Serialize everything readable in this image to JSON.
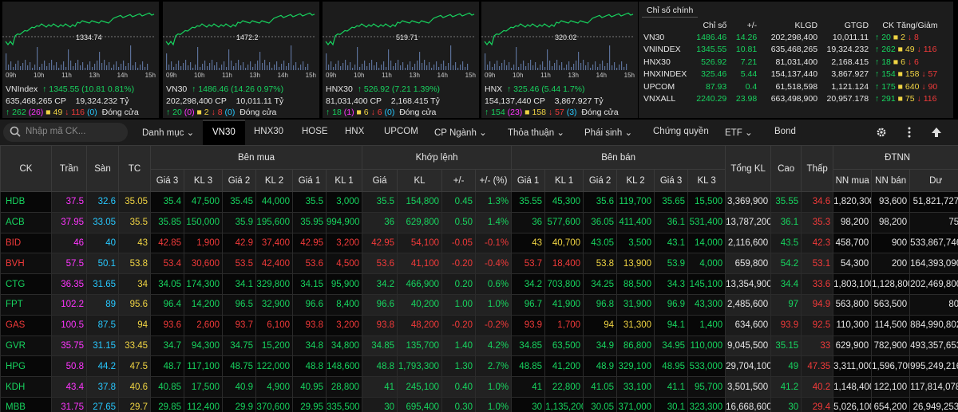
{
  "mini_charts": [
    {
      "name": "VNIndex",
      "ref_label": "1334.74",
      "price": "1345.55",
      "change": "(10.81 0.81%)",
      "vol": "635,468,265 CP",
      "value": "19,324.232 Tỷ",
      "up": "262",
      "ceil_up": "(26)",
      "same": "49",
      "down": "116",
      "floor_down": "(0)",
      "status": "Đóng cửa"
    },
    {
      "name": "VN30",
      "ref_label": "1472.2",
      "price": "1486.46",
      "change": "(14.26 0.97%)",
      "vol": "202,298,400 CP",
      "value": "10,011.11 Tỷ",
      "up": "20",
      "ceil_up": "(0)",
      "same": "2",
      "down": "8",
      "floor_down": "(0)",
      "status": "Đóng cửa"
    },
    {
      "name": "HNX30",
      "ref_label": "519.71",
      "price": "526.92",
      "change": "(7.21 1.39%)",
      "vol": "81,031,400 CP",
      "value": "2,168.415 Tỷ",
      "up": "18",
      "ceil_up": "(1)",
      "same": "6",
      "down": "6",
      "floor_down": "(0)",
      "status": "Đóng cửa"
    },
    {
      "name": "HNX",
      "ref_label": "320.02",
      "price": "325.46",
      "change": "(5.44 1.7%)",
      "vol": "154,137,440 CP",
      "value": "3,867.927 Tỷ",
      "up": "154",
      "ceil_up": "(23)",
      "same": "158",
      "down": "57",
      "floor_down": "(3)",
      "status": "Đóng cửa"
    }
  ],
  "time_ticks": [
    "09h",
    "10h",
    "11h",
    "13h",
    "14h",
    "15h"
  ],
  "summary": {
    "tab": "Chỉ số chính",
    "headers": [
      "Chỉ số",
      "+/-",
      "KLGD",
      "GTGD",
      "CK Tăng/Giảm"
    ],
    "rows": [
      {
        "name": "VN30",
        "index": "1486.46",
        "chg": "14.26",
        "klgd": "202,298,400",
        "gtgd": "10,011.11",
        "up": "20",
        "same": "2",
        "down": "8"
      },
      {
        "name": "VNINDEX",
        "index": "1345.55",
        "chg": "10.81",
        "klgd": "635,468,265",
        "gtgd": "19,324.232",
        "up": "262",
        "same": "49",
        "down": "116"
      },
      {
        "name": "HNX30",
        "index": "526.92",
        "chg": "7.21",
        "klgd": "81,031,400",
        "gtgd": "2,168.415",
        "up": "18",
        "same": "6",
        "down": "6"
      },
      {
        "name": "HNXINDEX",
        "index": "325.46",
        "chg": "5.44",
        "klgd": "154,137,440",
        "gtgd": "3,867.927",
        "up": "154",
        "same": "158",
        "down": "57"
      },
      {
        "name": "UPCOM",
        "index": "87.93",
        "chg": "0.4",
        "klgd": "61,518,598",
        "gtgd": "1,121.124",
        "up": "175",
        "same": "640",
        "down": "90"
      },
      {
        "name": "VNXALL",
        "index": "2240.29",
        "chg": "23.98",
        "klgd": "663,498,900",
        "gtgd": "20,957.178",
        "up": "291",
        "same": "75",
        "down": "116"
      }
    ]
  },
  "nav": {
    "search_placeholder": "Nhập mã CK...",
    "items": [
      "Danh mục",
      "VN30",
      "HNX30",
      "HOSE",
      "HNX",
      "UPCOM",
      "CP Ngành",
      "Thỏa thuận",
      "Phái sinh",
      "Chứng quyền",
      "ETF",
      "Bond"
    ]
  },
  "table": {
    "group_headers": [
      "CK",
      "Trần",
      "Sàn",
      "TC",
      "Bên mua",
      "Khớp lệnh",
      "Bên bán",
      "Tổng KL",
      "Cao",
      "Thấp",
      "ĐTNN"
    ],
    "sub_headers": [
      "Giá 3",
      "KL 3",
      "Giá 2",
      "KL 2",
      "Giá 1",
      "KL 1",
      "Giá",
      "KL",
      "+/-",
      "+/- (%)",
      "Giá 1",
      "KL 1",
      "Giá 2",
      "KL 2",
      "Giá 3",
      "KL 3",
      "NN mua",
      "NN bán",
      "Dư"
    ],
    "rows": [
      [
        "HDB",
        "37.5",
        "32.6",
        "35.05",
        "35.4",
        "47,500",
        "35.45",
        "44,000",
        "35.5",
        "3,000",
        "35.5",
        "154,800",
        "0.45",
        "1.3%",
        "35.55",
        "45,300",
        "35.6",
        "119,700",
        "35.65",
        "15,500",
        "3,369,900",
        "35.55",
        "34.6",
        "1,820,300",
        "93,600",
        "51,821,727"
      ],
      [
        "ACB",
        "37.95",
        "33.05",
        "35.5",
        "35.85",
        "150,000",
        "35.9",
        "195,600",
        "35.95",
        "994,900",
        "36",
        "629,800",
        "0.50",
        "1.4%",
        "36",
        "577,600",
        "36.05",
        "411,400",
        "36.1",
        "531,400",
        "13,787,200",
        "36.1",
        "35.3",
        "98,200",
        "98,200",
        "75"
      ],
      [
        "BID",
        "46",
        "40",
        "43",
        "42.85",
        "1,900",
        "42.9",
        "37,400",
        "42.95",
        "3,200",
        "42.95",
        "54,100",
        "-0.05",
        "-0.1%",
        "43",
        "40,700",
        "43.05",
        "3,500",
        "43.1",
        "14,000",
        "2,116,600",
        "43.5",
        "42.3",
        "458,700",
        "900",
        "533,867,746"
      ],
      [
        "BVH",
        "57.5",
        "50.1",
        "53.8",
        "53.4",
        "30,600",
        "53.5",
        "42,400",
        "53.6",
        "4,500",
        "53.6",
        "41,100",
        "-0.20",
        "-0.4%",
        "53.7",
        "18,400",
        "53.8",
        "13,900",
        "53.9",
        "4,000",
        "659,800",
        "54.2",
        "53.1",
        "54,300",
        "200",
        "164,393,090"
      ],
      [
        "CTG",
        "36.35",
        "31.65",
        "34",
        "34.05",
        "174,300",
        "34.1",
        "329,800",
        "34.15",
        "95,900",
        "34.2",
        "466,900",
        "0.20",
        "0.6%",
        "34.2",
        "703,800",
        "34.25",
        "88,500",
        "34.3",
        "145,100",
        "13,354,900",
        "34.4",
        "33.6",
        "1,803,100",
        "1,128,800",
        "202,469,800"
      ],
      [
        "FPT",
        "102.2",
        "89",
        "95.6",
        "96.4",
        "14,200",
        "96.5",
        "32,900",
        "96.6",
        "8,400",
        "96.6",
        "40,200",
        "1.00",
        "1.0%",
        "96.7",
        "41,900",
        "96.8",
        "31,900",
        "96.9",
        "43,300",
        "2,485,600",
        "97",
        "94.9",
        "563,800",
        "563,500",
        "80"
      ],
      [
        "GAS",
        "100.5",
        "87.5",
        "94",
        "93.6",
        "2,600",
        "93.7",
        "6,100",
        "93.8",
        "3,200",
        "93.8",
        "48,200",
        "-0.20",
        "-0.2%",
        "93.9",
        "1,700",
        "94",
        "31,300",
        "94.1",
        "1,400",
        "634,600",
        "93.9",
        "92.5",
        "110,300",
        "114,500",
        "884,990,802"
      ],
      [
        "GVR",
        "35.75",
        "31.15",
        "33.45",
        "34.7",
        "94,300",
        "34.75",
        "15,200",
        "34.8",
        "34,800",
        "34.85",
        "135,700",
        "1.40",
        "4.2%",
        "34.85",
        "63,500",
        "34.9",
        "86,800",
        "34.95",
        "110,000",
        "9,045,500",
        "35.15",
        "33",
        "629,900",
        "782,900",
        "493,357,653"
      ],
      [
        "HPG",
        "50.8",
        "44.2",
        "47.5",
        "48.7",
        "117,100",
        "48.75",
        "122,000",
        "48.8",
        "148,600",
        "48.8",
        "1,793,300",
        "1.30",
        "2.7%",
        "48.85",
        "41,200",
        "48.9",
        "329,100",
        "48.95",
        "533,000",
        "29,704,100",
        "49",
        "47.35",
        "3,311,000",
        "1,596,700",
        "995,249,216"
      ],
      [
        "KDH",
        "43.4",
        "37.8",
        "40.6",
        "40.85",
        "17,500",
        "40.9",
        "4,900",
        "40.95",
        "28,800",
        "41",
        "245,100",
        "0.40",
        "1.0%",
        "41",
        "22,800",
        "41.05",
        "33,100",
        "41.1",
        "95,700",
        "3,501,500",
        "41.2",
        "40.2",
        "1,148,400",
        "122,100",
        "117,814,078"
      ],
      [
        "MBB",
        "31.75",
        "27.65",
        "29.7",
        "29.85",
        "112,400",
        "29.9",
        "370,600",
        "29.95",
        "335,500",
        "30",
        "695,400",
        "0.30",
        "1.0%",
        "30",
        "1,135,200",
        "30.05",
        "371,000",
        "30.1",
        "323,300",
        "16,668,600",
        "30",
        "29.4",
        "5,026,100",
        "654,200",
        "26,949,253"
      ]
    ]
  },
  "colors": {
    "up": "#17d45f",
    "down": "#f23a3a",
    "ref": "#f0d443",
    "ceil": "#ff35ff",
    "floor": "#27c8ff",
    "line": "#1ea34a"
  }
}
